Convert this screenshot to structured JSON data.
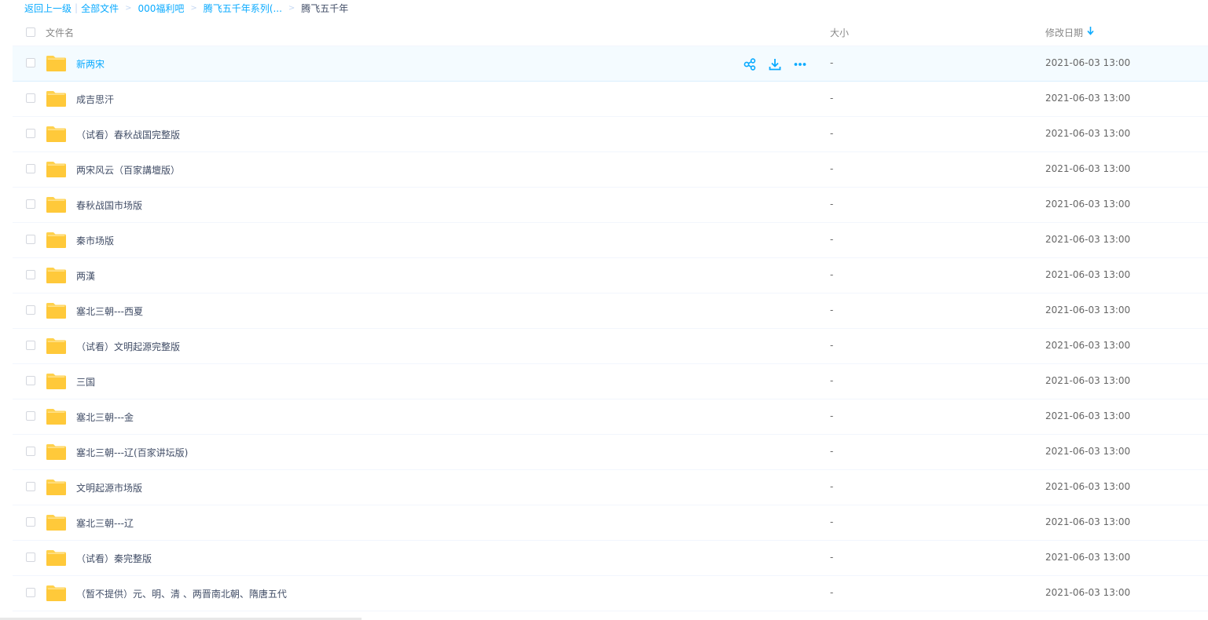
{
  "breadcrumb": {
    "back": "返回上一级",
    "items": [
      "全部文件",
      "000福利吧",
      "腾飞五千年系列(...",
      "腾飞五千年"
    ]
  },
  "header": {
    "name": "文件名",
    "size": "大小",
    "date": "修改日期"
  },
  "colors": {
    "accent": "#09aaff",
    "folder": "#ffd14d",
    "hover_row": "#f4fbff"
  },
  "rows": [
    {
      "name": "新两宋",
      "size": "-",
      "date": "2021-06-03 13:00"
    },
    {
      "name": "成吉思汗",
      "size": "-",
      "date": "2021-06-03 13:00"
    },
    {
      "name": "（试看）春秋战国完整版",
      "size": "-",
      "date": "2021-06-03 13:00"
    },
    {
      "name": "两宋风云（百家講壇版）",
      "size": "-",
      "date": "2021-06-03 13:00"
    },
    {
      "name": "春秋战国市场版",
      "size": "-",
      "date": "2021-06-03 13:00"
    },
    {
      "name": "秦市场版",
      "size": "-",
      "date": "2021-06-03 13:00"
    },
    {
      "name": "两漢",
      "size": "-",
      "date": "2021-06-03 13:00"
    },
    {
      "name": "塞北三朝---西夏",
      "size": "-",
      "date": "2021-06-03 13:00"
    },
    {
      "name": "（试看）文明起源完整版",
      "size": "-",
      "date": "2021-06-03 13:00"
    },
    {
      "name": "三国",
      "size": "-",
      "date": "2021-06-03 13:00"
    },
    {
      "name": "塞北三朝---金",
      "size": "-",
      "date": "2021-06-03 13:00"
    },
    {
      "name": "塞北三朝---辽(百家讲坛版)",
      "size": "-",
      "date": "2021-06-03 13:00"
    },
    {
      "name": "文明起源市场版",
      "size": "-",
      "date": "2021-06-03 13:00"
    },
    {
      "name": "塞北三朝---辽",
      "size": "-",
      "date": "2021-06-03 13:00"
    },
    {
      "name": "（试看）秦完整版",
      "size": "-",
      "date": "2021-06-03 13:00"
    },
    {
      "name": "（暂不提供）元、明、清 、两晋南北朝、隋唐五代",
      "size": "-",
      "date": "2021-06-03 13:00"
    }
  ],
  "row_actions": [
    "share-icon",
    "download-icon",
    "more-icon"
  ]
}
